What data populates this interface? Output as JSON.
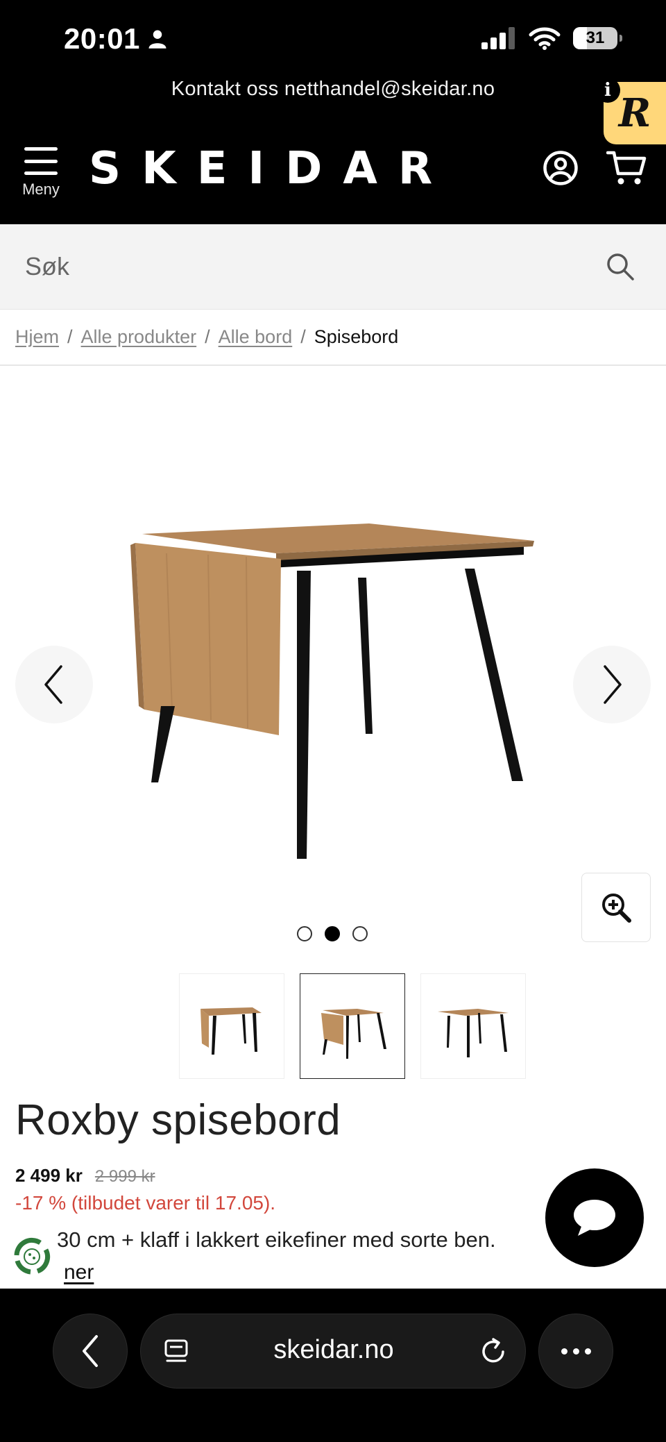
{
  "status_bar": {
    "time": "20:01",
    "battery": "31",
    "battery_level": 0.31
  },
  "header": {
    "contact": "Kontakt oss netthandel@skeidar.no",
    "menu_label": "Meny",
    "logo": "SKEIDAR",
    "rewards_badge": "R",
    "rewards_info": "i"
  },
  "search": {
    "placeholder": "Søk"
  },
  "breadcrumb": {
    "items": [
      "Hjem",
      "Alle produkter",
      "Alle bord"
    ],
    "current": "Spisebord",
    "separator": "/"
  },
  "gallery": {
    "image_count": 3,
    "active_index": 1
  },
  "product": {
    "title": "Roxby spisebord",
    "price": "2 499 kr",
    "old_price": "2 999 kr",
    "discount": "-17 % (tilbudet varer til 17.05).",
    "description_visible": "30 cm + klaff i lakkert eikefiner med sorte ben.",
    "read_more_visible": "ner"
  },
  "browser": {
    "url": "skeidar.no"
  },
  "colors": {
    "header_bg": "#000000",
    "discount": "#d2473c",
    "rewards_badge": "#ffd77a",
    "table_wood": "#b38458",
    "table_legs": "#111111"
  },
  "icons": [
    "person-icon",
    "signal-icon",
    "wifi-icon",
    "battery-icon",
    "menu-icon",
    "account-icon",
    "cart-icon",
    "search-icon",
    "chevron-left-icon",
    "chevron-right-icon",
    "zoom-in-icon",
    "chat-icon",
    "recycle-icon",
    "back-icon",
    "tabs-icon",
    "reload-icon",
    "more-icon"
  ]
}
